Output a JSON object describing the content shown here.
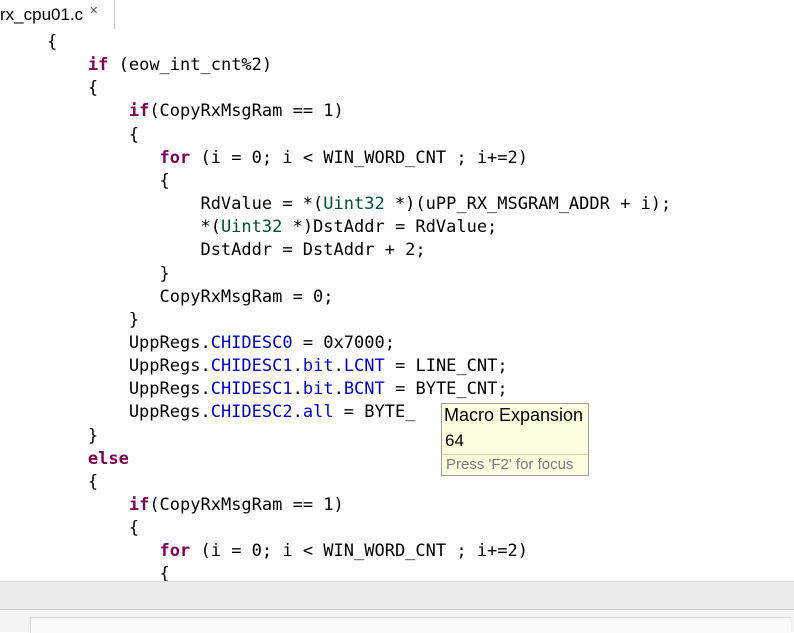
{
  "tab": {
    "label": "rx_cpu01.c",
    "close_glyph": "✕"
  },
  "code_lines": [
    [
      {
        "t": "    {",
        "c": ""
      }
    ],
    [
      {
        "t": "        ",
        "c": ""
      },
      {
        "t": "if",
        "c": "kw"
      },
      {
        "t": " (eow_int_cnt%2)",
        "c": ""
      }
    ],
    [
      {
        "t": "        {",
        "c": ""
      }
    ],
    [
      {
        "t": "            ",
        "c": ""
      },
      {
        "t": "if",
        "c": "kw"
      },
      {
        "t": "(CopyRxMsgRam == 1)",
        "c": ""
      }
    ],
    [
      {
        "t": "            {",
        "c": ""
      }
    ],
    [
      {
        "t": "               ",
        "c": ""
      },
      {
        "t": "for",
        "c": "kw"
      },
      {
        "t": " (i = 0; i < WIN_WORD_CNT ; i+=2)",
        "c": ""
      }
    ],
    [
      {
        "t": "               {",
        "c": ""
      }
    ],
    [
      {
        "t": "                   RdValue = *(",
        "c": ""
      },
      {
        "t": "Uint32",
        "c": "ty"
      },
      {
        "t": " *)(uPP_RX_MSGRAM_ADDR + i);",
        "c": ""
      }
    ],
    [
      {
        "t": "                   *(",
        "c": ""
      },
      {
        "t": "Uint32",
        "c": "ty"
      },
      {
        "t": " *)DstAddr = RdValue;",
        "c": ""
      }
    ],
    [
      {
        "t": "                   DstAddr = DstAddr + 2;",
        "c": ""
      }
    ],
    [
      {
        "t": "               }",
        "c": ""
      }
    ],
    [
      {
        "t": "               CopyRxMsgRam = 0;",
        "c": ""
      }
    ],
    [
      {
        "t": "            }",
        "c": ""
      }
    ],
    [
      {
        "t": "            UppRegs.",
        "c": ""
      },
      {
        "t": "CHIDESC0",
        "c": "fd"
      },
      {
        "t": " = 0x7000;",
        "c": ""
      }
    ],
    [
      {
        "t": "            UppRegs.",
        "c": ""
      },
      {
        "t": "CHIDESC1",
        "c": "fd"
      },
      {
        "t": ".",
        "c": ""
      },
      {
        "t": "bit",
        "c": "fd"
      },
      {
        "t": ".",
        "c": ""
      },
      {
        "t": "LCNT",
        "c": "fd"
      },
      {
        "t": " = LINE_CNT;",
        "c": ""
      }
    ],
    [
      {
        "t": "            UppRegs.",
        "c": ""
      },
      {
        "t": "CHIDESC1",
        "c": "fd"
      },
      {
        "t": ".",
        "c": ""
      },
      {
        "t": "bit",
        "c": "fd"
      },
      {
        "t": ".",
        "c": ""
      },
      {
        "t": "BCNT",
        "c": "fd"
      },
      {
        "t": " = BYTE_CNT;",
        "c": ""
      }
    ],
    [
      {
        "t": "            UppRegs.",
        "c": ""
      },
      {
        "t": "CHIDESC2",
        "c": "fd"
      },
      {
        "t": ".",
        "c": ""
      },
      {
        "t": "all",
        "c": "fd"
      },
      {
        "t": " = BYTE_",
        "c": ""
      }
    ],
    [
      {
        "t": "        }",
        "c": ""
      }
    ],
    [
      {
        "t": "        ",
        "c": ""
      },
      {
        "t": "else",
        "c": "kw"
      }
    ],
    [
      {
        "t": "        {",
        "c": ""
      }
    ],
    [
      {
        "t": "            ",
        "c": ""
      },
      {
        "t": "if",
        "c": "kw"
      },
      {
        "t": "(CopyRxMsgRam == 1)",
        "c": ""
      }
    ],
    [
      {
        "t": "            {",
        "c": ""
      }
    ],
    [
      {
        "t": "               ",
        "c": ""
      },
      {
        "t": "for",
        "c": "kw"
      },
      {
        "t": " (i = 0; i < WIN_WORD_CNT ; i+=2)",
        "c": ""
      }
    ],
    [
      {
        "t": "               {",
        "c": ""
      }
    ]
  ],
  "tooltip": {
    "title": "Macro Expansion",
    "value": "64",
    "hint": "Press 'F2' for focus"
  },
  "colors": {
    "keyword": "#7f0055",
    "type": "#005032",
    "field": "#0000c0",
    "tooltip_bg": "#ffffe1"
  }
}
